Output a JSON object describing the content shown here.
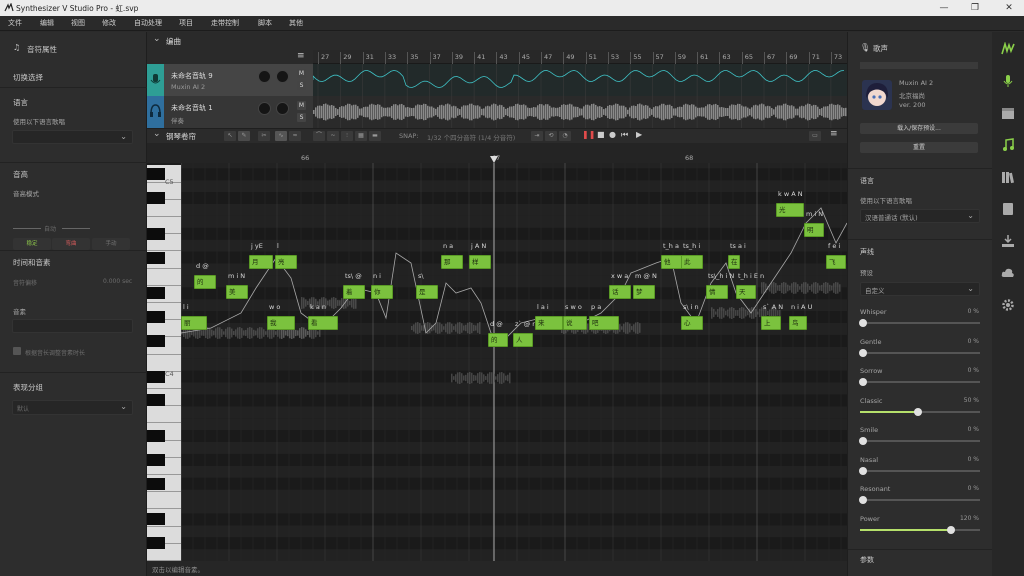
{
  "window": {
    "title": "Synthesizer V Studio Pro - 虹.svp",
    "minimize_glyph": "—",
    "maximize_glyph": "❐",
    "close_glyph": "✕"
  },
  "menu": [
    "文件",
    "编辑",
    "视图",
    "修改",
    "自动处理",
    "项目",
    "走带控制",
    "脚本",
    "其他"
  ],
  "left_panel": {
    "title": "音符属性",
    "switch_label": "切换选择",
    "language_title": "语言",
    "language_hint": "使用以下语言歌唱",
    "pitch_title": "音高",
    "pitch_mode_label": "音高模式",
    "pitch_modes": [
      "稳定",
      "弯曲",
      "手动"
    ],
    "auto_label": "自动",
    "timing_title": "时间和音素",
    "offset_label": "音符偏移",
    "offset_value": "0.000 sec",
    "phoneme_label": "音素",
    "checkbox_label": "根据音长调整音素时长",
    "expression_title": "表现分组",
    "expression_value": "默认"
  },
  "arrangement": {
    "title": "编曲",
    "menu_glyph": "≡",
    "measures": [
      "27",
      "29",
      "31",
      "33",
      "35",
      "37",
      "39",
      "41",
      "43",
      "45",
      "47",
      "49",
      "51",
      "53",
      "55",
      "57",
      "59",
      "61",
      "63",
      "65",
      "67",
      "69",
      "71",
      "73"
    ],
    "tracks": [
      {
        "name": "未命名音轨 9",
        "sub": "Muxin AI 2",
        "color": "#2e9e95",
        "mute": "M",
        "solo": "S"
      },
      {
        "name": "未命名音轨 1",
        "sub": "伴奏",
        "color": "#2f6f9e",
        "mute": "M",
        "solo": "S"
      }
    ]
  },
  "pianoroll": {
    "title": "钢琴卷帘",
    "snap_label": "SNAP:",
    "snap_value": "1/32 个四分音符 (1/4 分音符)",
    "measures": [
      "66",
      "67",
      "68"
    ],
    "key_labels": [
      "C5",
      "C4"
    ],
    "notes": [
      {
        "text": "月",
        "lyric": "j yE"
      },
      {
        "text": "亮",
        "lyric": "l"
      },
      {
        "text": "的",
        "lyric": "d @"
      },
      {
        "text": "美",
        "lyric": "m i N"
      },
      {
        "text": "丽",
        "lyric": "l i"
      },
      {
        "text": "我",
        "lyric": "w o"
      },
      {
        "text": "看",
        "lyric": "k a n"
      },
      {
        "text": "着",
        "lyric": "ts\\ @"
      },
      {
        "text": "你",
        "lyric": "n i"
      },
      {
        "text": "是",
        "lyric": "s\\"
      },
      {
        "text": "那",
        "lyric": "n a"
      },
      {
        "text": "样",
        "lyric": "j A N"
      },
      {
        "text": "的",
        "lyric": "d @"
      },
      {
        "text": "人",
        "lyric": "z` @ n"
      },
      {
        "text": "来",
        "lyric": "l a i"
      },
      {
        "text": "说",
        "lyric": "s w o"
      },
      {
        "text": "吧",
        "lyric": "p a"
      },
      {
        "text": "话",
        "lyric": "x w a"
      },
      {
        "text": "梦",
        "lyric": "m @ N"
      },
      {
        "text": "他",
        "lyric": "t_h a"
      },
      {
        "text": "此",
        "lyric": "ts_h i"
      },
      {
        "text": "情",
        "lyric": "ts\\_h i N"
      },
      {
        "text": "在",
        "lyric": "ts a i"
      },
      {
        "text": "天",
        "lyric": "t_h i E n"
      },
      {
        "text": "上",
        "lyric": "s` A N"
      },
      {
        "text": "光",
        "lyric": "k w A N"
      },
      {
        "text": "明",
        "lyric": "m i N"
      },
      {
        "text": "飞",
        "lyric": "f e i"
      },
      {
        "text": "心",
        "lyric": "s\\ i n"
      },
      {
        "text": "鸟",
        "lyric": "n i A U"
      }
    ]
  },
  "status_bar": {
    "text": "双击以编辑音素。"
  },
  "right_panel": {
    "title": "歌声",
    "voice_name": "Muxin AI 2",
    "voice_company": "北京福尚",
    "voice_version": "ver. 200",
    "load_button": "载入/保存预设...",
    "reset_button": "重置",
    "language_title": "语言",
    "language_hint": "使用以下语言歌唱",
    "language_value": "汉语普通话 (默认)",
    "voice_title": "声线",
    "preset_label": "预设",
    "preset_value": "自定义",
    "modes": [
      {
        "name": "Whisper",
        "value": "0 %",
        "level": 0
      },
      {
        "name": "Gentle",
        "value": "0 %",
        "level": 0
      },
      {
        "name": "Sorrow",
        "value": "0 %",
        "level": 0
      },
      {
        "name": "Classic",
        "value": "50 %",
        "level": 0.5
      },
      {
        "name": "Smile",
        "value": "0 %",
        "level": 0
      },
      {
        "name": "Nasal",
        "value": "0 %",
        "level": 0
      },
      {
        "name": "Resonant",
        "value": "0 %",
        "level": 0
      },
      {
        "name": "Power",
        "value": "120 %",
        "level": 0.8
      }
    ],
    "params_title": "参数"
  },
  "sidebar": {
    "icons": [
      "logo-icon",
      "microphone-icon",
      "clapperboard-icon",
      "music-note-icon",
      "library-icon",
      "book-icon",
      "import-icon",
      "cloud-icon",
      "settings-icon"
    ],
    "active_color": "#8bd04a"
  }
}
